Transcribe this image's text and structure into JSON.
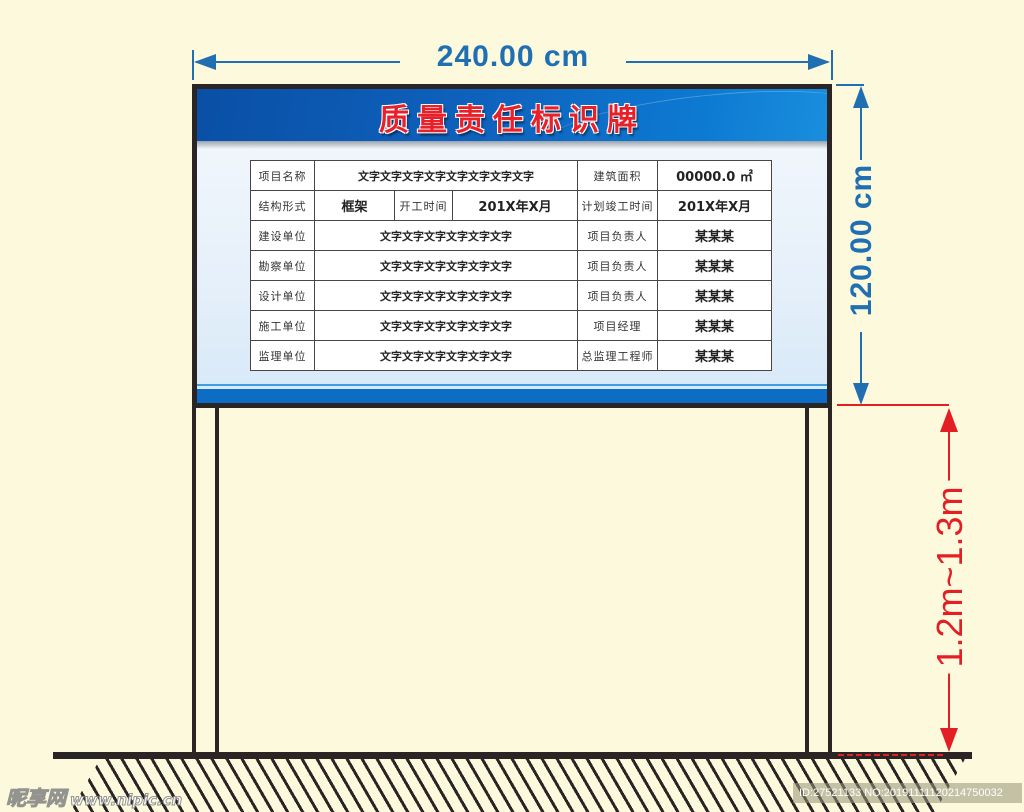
{
  "dimensions": {
    "width_label": "240.00 cm",
    "height_label": "120.00 cm",
    "mount_height_label": "1.2m~1.3m"
  },
  "colors": {
    "dimension_blue": "#1f6fb2",
    "dimension_red": "#e31e24",
    "title_red": "#e8202a",
    "header_blue": "#0e62bd",
    "frame": "#2a2424",
    "background": "#fdf9dc"
  },
  "board": {
    "title": "质量责任标识牌",
    "table": {
      "rows": [
        {
          "label": "项目名称",
          "value": "文字文字文字文字文字文字文字文字",
          "label2": "建筑面积",
          "value2": "00000.0 ㎡"
        },
        {
          "label": "结构形式",
          "value": "框架",
          "mid_label": "开工时间",
          "mid_value": "201X年X月",
          "label2": "计划竣工时间",
          "value2": "201X年X月"
        },
        {
          "label": "建设单位",
          "value": "文字文字文字文字文字文字",
          "label2": "项目负责人",
          "value2": "某某某"
        },
        {
          "label": "勘察单位",
          "value": "文字文字文字文字文字文字",
          "label2": "项目负责人",
          "value2": "某某某"
        },
        {
          "label": "设计单位",
          "value": "文字文字文字文字文字文字",
          "label2": "项目负责人",
          "value2": "某某某"
        },
        {
          "label": "施工单位",
          "value": "文字文字文字文字文字文字",
          "label2": "项目经理",
          "value2": "某某某"
        },
        {
          "label": "监理单位",
          "value": "文字文字文字文字文字文字",
          "label2": "总监理工程师",
          "value2": "某某某"
        }
      ]
    }
  },
  "watermarks": {
    "site_name": "昵享网",
    "site_url": "www.nipic.cn",
    "id_text": "ID:27521133 NO:20191111120214750032"
  }
}
